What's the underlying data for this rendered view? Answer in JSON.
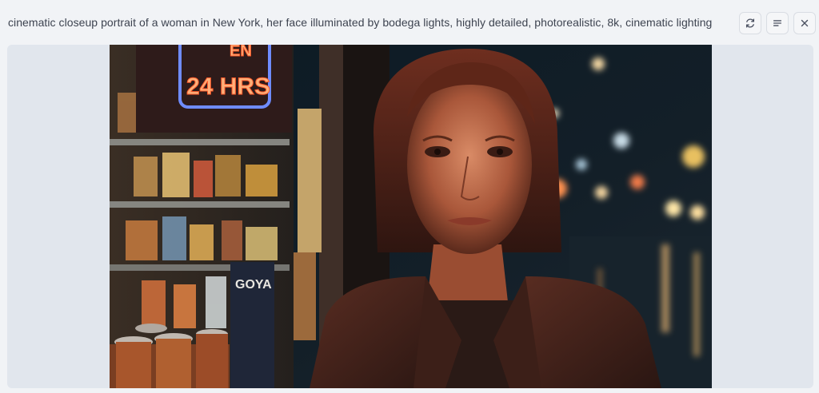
{
  "prompt_text": "cinematic closeup portrait of a woman in New York, her face illuminated by bodega lights, highly detailed, photorealistic, 8k, cinematic lighting",
  "toolbar": {
    "refresh_icon": "refresh-icon",
    "menu_icon": "menu-lines-icon",
    "close_icon": "close-icon"
  },
  "image": {
    "alt": "photograph",
    "sign_text": "24 HRS",
    "sign_text_top": "EN",
    "box_brand": "GOYA"
  },
  "colors": {
    "page_bg": "#f1f3f6",
    "panel_bg": "#e1e6ed",
    "neon_red": "#ff5a2a",
    "neon_blue": "#6f8cff"
  }
}
